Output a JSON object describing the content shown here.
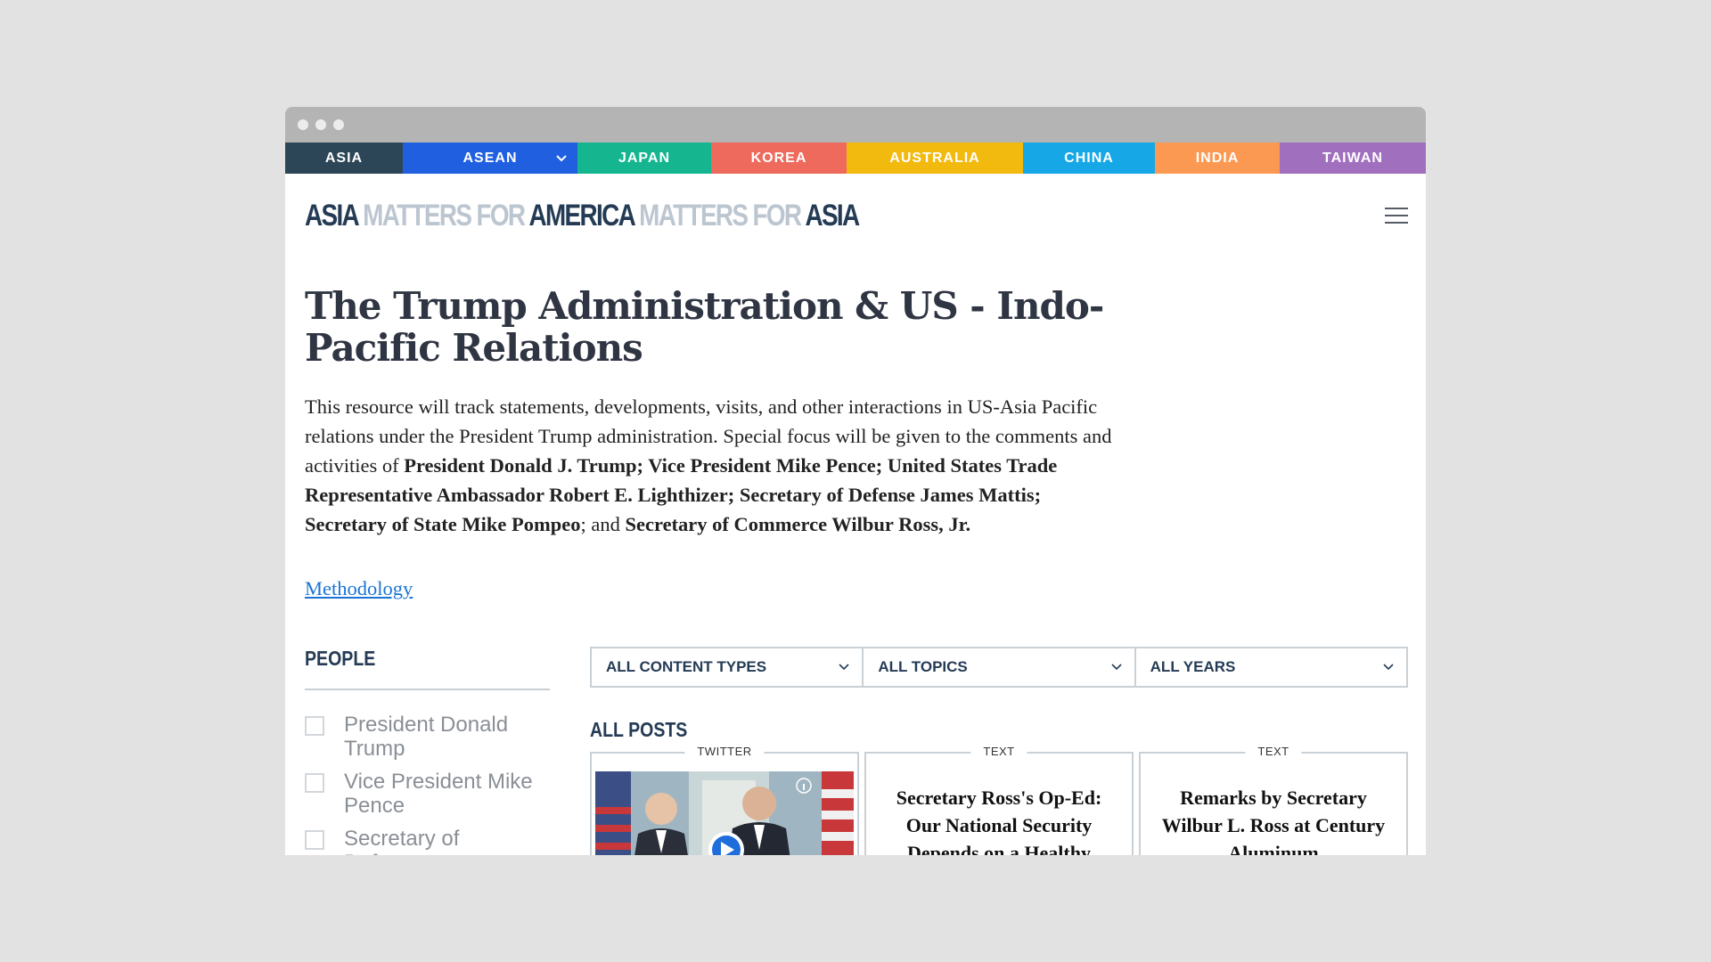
{
  "country_nav": [
    {
      "label": "ASIA",
      "color": "#2d4657"
    },
    {
      "label": "ASEAN",
      "color": "#1f5fe0",
      "has_dropdown": true
    },
    {
      "label": "JAPAN",
      "color": "#15b590"
    },
    {
      "label": "KOREA",
      "color": "#ee6a5c"
    },
    {
      "label": "AUSTRALIA",
      "color": "#f2b90f"
    },
    {
      "label": "CHINA",
      "color": "#16a8e6"
    },
    {
      "label": "INDIA",
      "color": "#fb9852"
    },
    {
      "label": "TAIWAN",
      "color": "#a06fbe"
    }
  ],
  "logo": {
    "part1": "ASIA",
    "part2": "MATTERS FOR",
    "part3": "AMERICA",
    "part4": "MATTERS FOR",
    "part5": "ASIA"
  },
  "page": {
    "title": "The Trump Administration & US - Indo-Pacific Relations",
    "intro_1": "This resource will track statements, developments, visits, and other interactions in US-Asia Pacific relations under the President Trump administration. Special focus will be given to the comments and activities of ",
    "intro_b1": "President Donald J. Trump; Vice President Mike Pence; United States Trade Representative Ambassador Robert E. Lighthizer; Secretary of Defense James Mattis; Secretary of State Mike Pompeo",
    "intro_2": "; and ",
    "intro_b2": "Secretary of Commerce Wilbur Ross, Jr.",
    "methodology_link": "Methodology"
  },
  "people": {
    "heading": "PEOPLE",
    "items": [
      "President Donald Trump",
      "Vice President Mike Pence",
      "Secretary of Defense"
    ]
  },
  "filters": [
    {
      "label": "ALL CONTENT TYPES"
    },
    {
      "label": "ALL TOPICS"
    },
    {
      "label": "ALL YEARS"
    }
  ],
  "posts": {
    "heading": "ALL POSTS",
    "cards": [
      {
        "type": "TWITTER",
        "title": ""
      },
      {
        "type": "TEXT",
        "title": "Secretary Ross's Op-Ed: Our National Security Depends on a Healthy"
      },
      {
        "type": "TEXT",
        "title": "Remarks by Secretary Wilbur L. Ross at Century Aluminum"
      }
    ]
  }
}
